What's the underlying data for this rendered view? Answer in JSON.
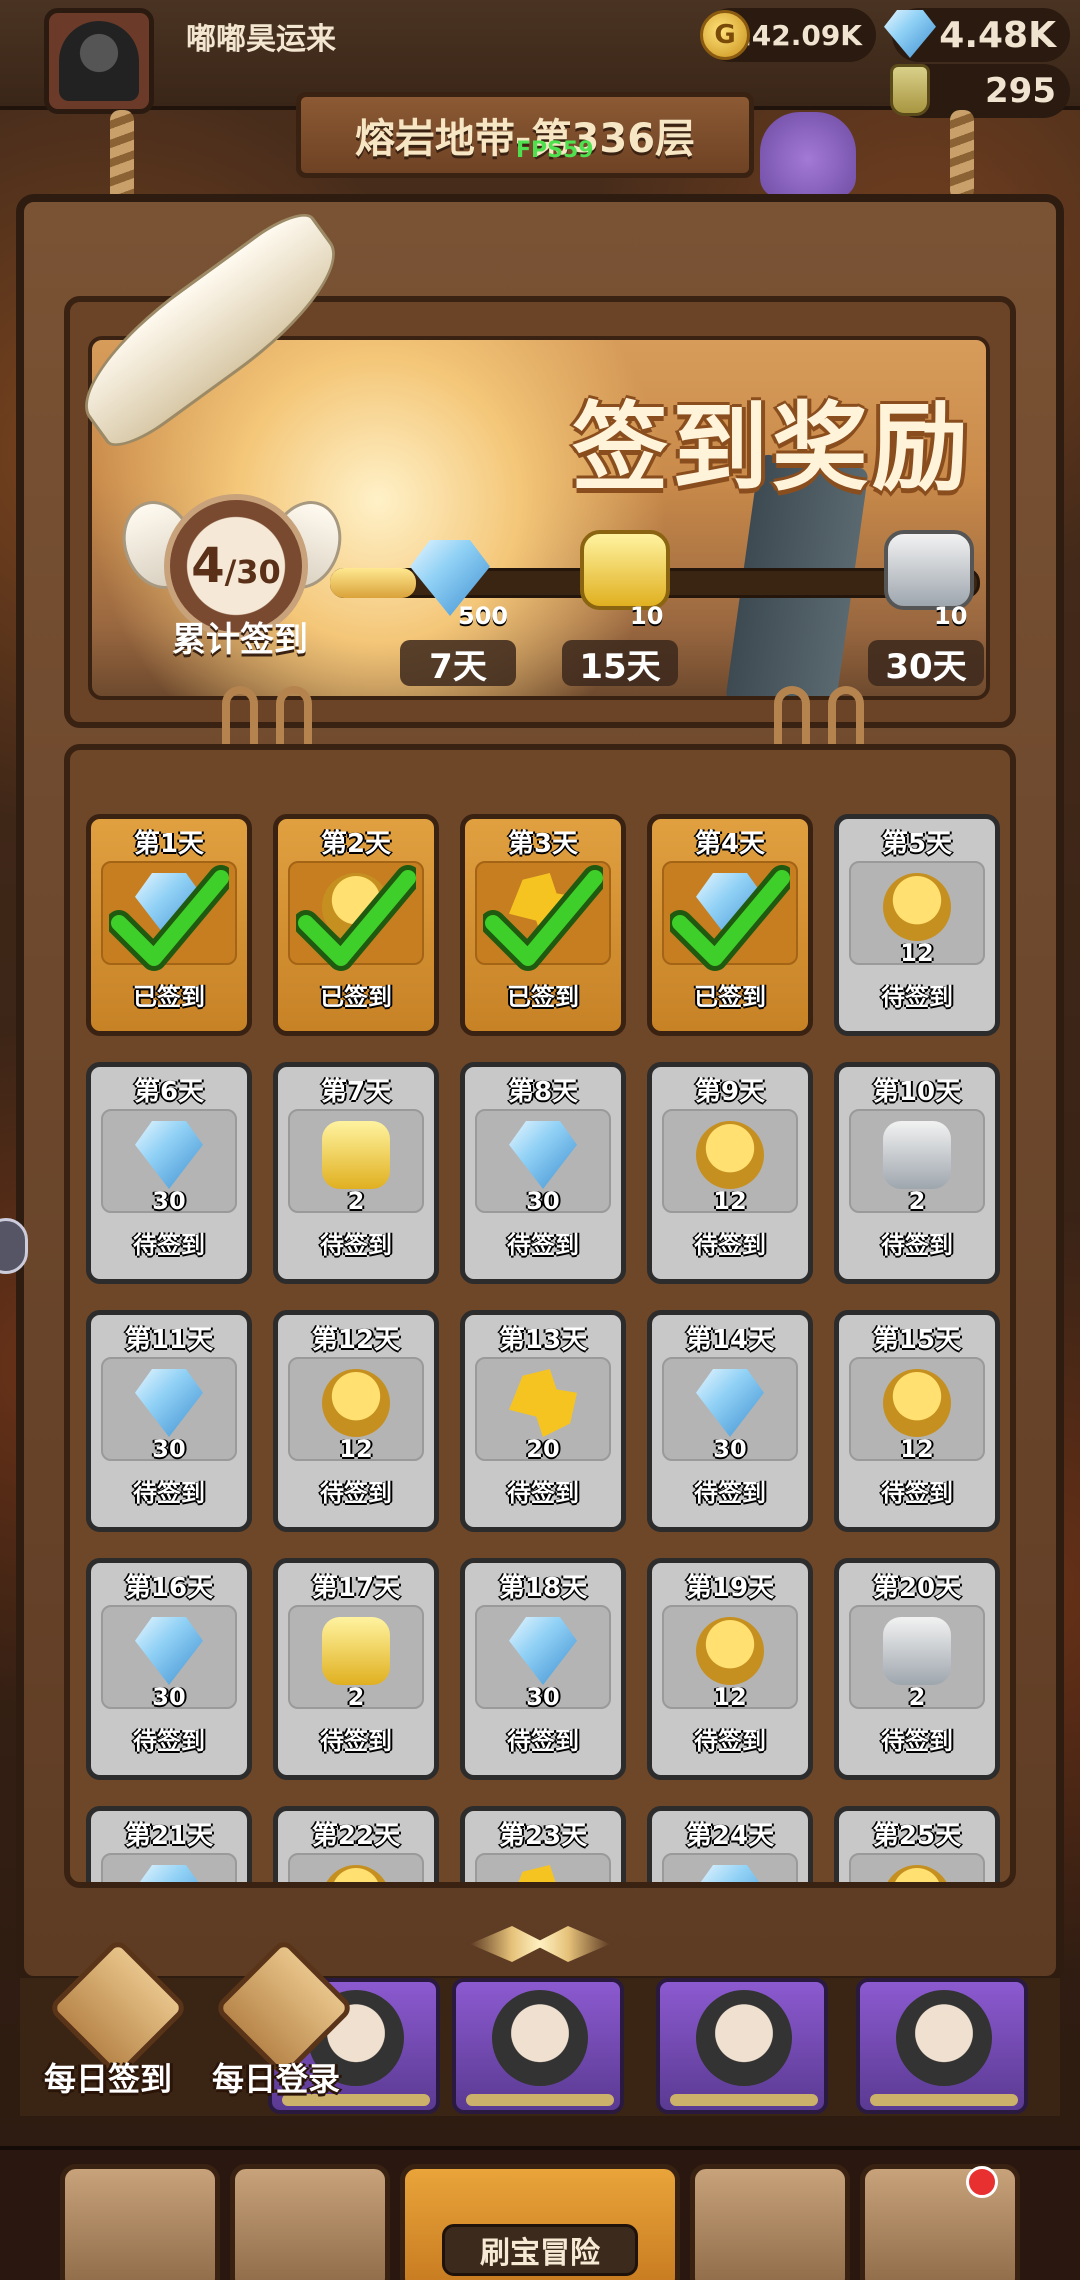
{
  "header": {
    "username": "嘟嘟昊运来",
    "gold": "242.09K",
    "gems": "4.48K",
    "potions": "295",
    "stage_title": "熔岩地带-第336层",
    "fps": "FPS59"
  },
  "signin": {
    "title": "签到奖励",
    "progress_current": "4",
    "progress_total": "/30",
    "progress_fraction": 0.133,
    "cumulative_label": "累计签到",
    "milestones": [
      {
        "icon": "gem-icon",
        "count": "500",
        "day": "7天"
      },
      {
        "icon": "gold-scroll-icon",
        "count": "10",
        "day": "15天"
      },
      {
        "icon": "silver-scroll-icon",
        "count": "10",
        "day": "30天"
      }
    ]
  },
  "days": [
    {
      "title": "第1天",
      "icon": "gem-icon",
      "count": "",
      "status": "已签到",
      "done": true
    },
    {
      "title": "第2天",
      "icon": "duck-hero-icon",
      "count": "",
      "status": "已签到",
      "done": true
    },
    {
      "title": "第3天",
      "icon": "puzzle-icon",
      "count": "",
      "status": "已签到",
      "done": true
    },
    {
      "title": "第4天",
      "icon": "gem-icon",
      "count": "",
      "status": "已签到",
      "done": true
    },
    {
      "title": "第5天",
      "icon": "duck-hero-icon",
      "count": "12",
      "status": "待签到",
      "done": false
    },
    {
      "title": "第6天",
      "icon": "gem-icon",
      "count": "30",
      "status": "待签到",
      "done": false
    },
    {
      "title": "第7天",
      "icon": "gold-scroll-icon",
      "count": "2",
      "status": "待签到",
      "done": false
    },
    {
      "title": "第8天",
      "icon": "gem-icon",
      "count": "30",
      "status": "待签到",
      "done": false
    },
    {
      "title": "第9天",
      "icon": "duck-hero-icon",
      "count": "12",
      "status": "待签到",
      "done": false
    },
    {
      "title": "第10天",
      "icon": "silver-scroll-icon",
      "count": "2",
      "status": "待签到",
      "done": false
    },
    {
      "title": "第11天",
      "icon": "gem-icon",
      "count": "30",
      "status": "待签到",
      "done": false
    },
    {
      "title": "第12天",
      "icon": "duck-hero-icon",
      "count": "12",
      "status": "待签到",
      "done": false
    },
    {
      "title": "第13天",
      "icon": "puzzle-icon",
      "count": "20",
      "status": "待签到",
      "done": false
    },
    {
      "title": "第14天",
      "icon": "gem-icon",
      "count": "30",
      "status": "待签到",
      "done": false
    },
    {
      "title": "第15天",
      "icon": "duck-hero-icon",
      "count": "12",
      "status": "待签到",
      "done": false
    },
    {
      "title": "第16天",
      "icon": "gem-icon",
      "count": "30",
      "status": "待签到",
      "done": false
    },
    {
      "title": "第17天",
      "icon": "gold-scroll-icon",
      "count": "2",
      "status": "待签到",
      "done": false
    },
    {
      "title": "第18天",
      "icon": "gem-icon",
      "count": "30",
      "status": "待签到",
      "done": false
    },
    {
      "title": "第19天",
      "icon": "duck-hero-icon",
      "count": "12",
      "status": "待签到",
      "done": false
    },
    {
      "title": "第20天",
      "icon": "silver-scroll-icon",
      "count": "2",
      "status": "待签到",
      "done": false
    },
    {
      "title": "第21天",
      "icon": "gem-icon",
      "count": "",
      "status": "",
      "done": false
    },
    {
      "title": "第22天",
      "icon": "duck-hero-icon",
      "count": "",
      "status": "",
      "done": false
    },
    {
      "title": "第23天",
      "icon": "puzzle-icon",
      "count": "",
      "status": "",
      "done": false
    },
    {
      "title": "第24天",
      "icon": "gem-icon",
      "count": "",
      "status": "",
      "done": false
    },
    {
      "title": "第25天",
      "icon": "duck-hero-icon",
      "count": "",
      "status": "",
      "done": false
    }
  ],
  "quick": {
    "daily_signin": "每日签到",
    "daily_login": "每日登录"
  },
  "bottom_nav": {
    "center_label": "刷宝冒险"
  },
  "colors": {
    "wood": "#6b4428",
    "done_card": "#d9942f",
    "pending_card": "#c8c8c8",
    "check_green": "#3fcf2a"
  }
}
